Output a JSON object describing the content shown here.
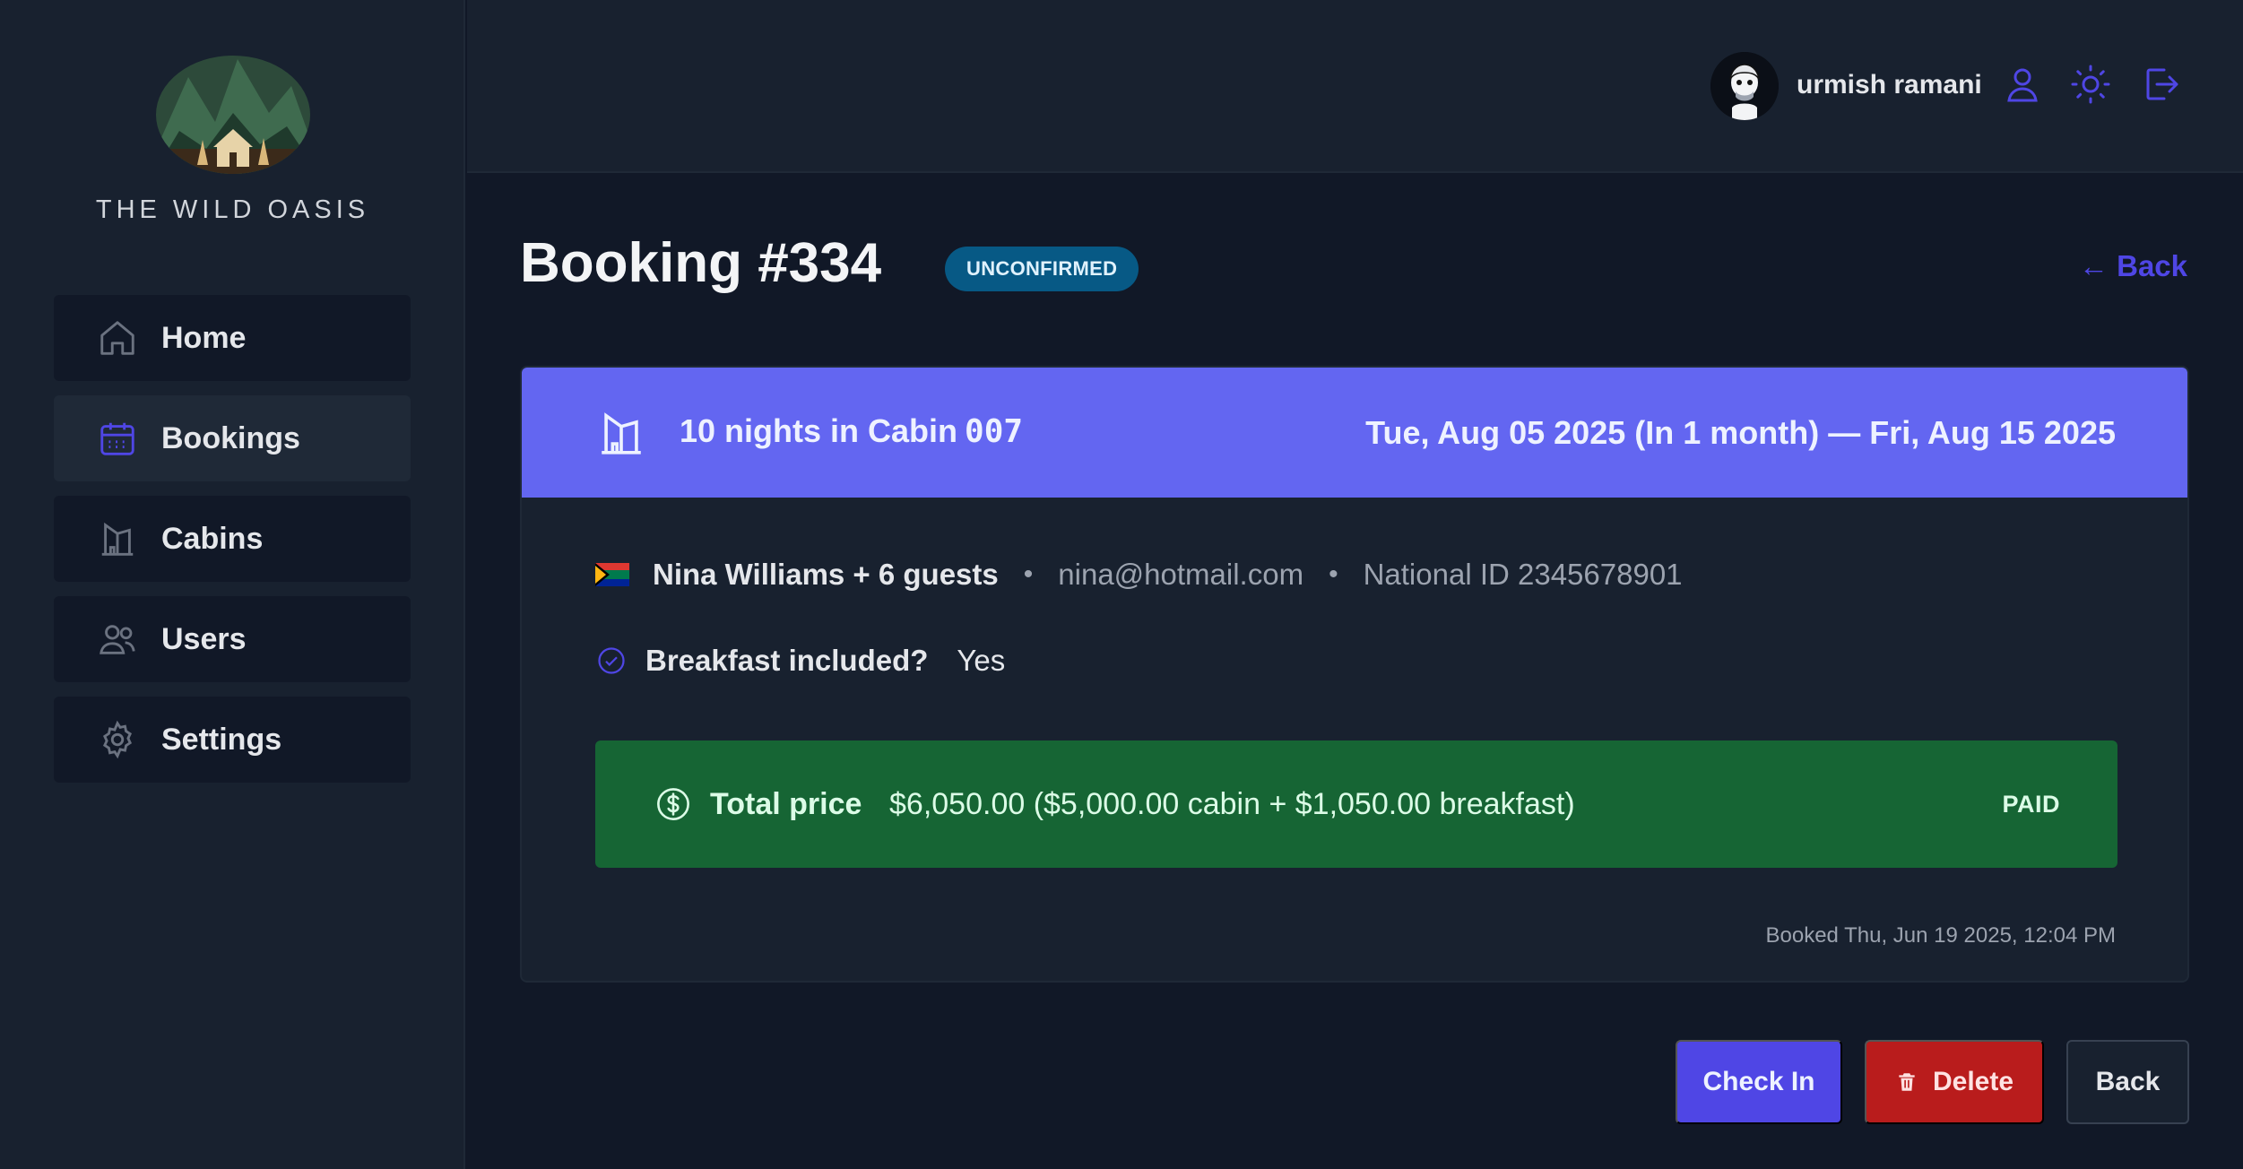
{
  "sidebar": {
    "brand": "THE WILD OASIS",
    "items": [
      {
        "label": "Home",
        "icon": "home-icon"
      },
      {
        "label": "Bookings",
        "icon": "calendar-icon"
      },
      {
        "label": "Cabins",
        "icon": "building-icon"
      },
      {
        "label": "Users",
        "icon": "users-icon"
      },
      {
        "label": "Settings",
        "icon": "gear-icon"
      }
    ],
    "active": "Bookings"
  },
  "header": {
    "username": "urmish ramani",
    "icons": [
      "user-icon",
      "sun-icon",
      "logout-icon"
    ]
  },
  "page": {
    "title": "Booking #334",
    "status": "UNCONFIRMED",
    "back_link": "← Back"
  },
  "booking": {
    "nights_text": "10 nights in Cabin",
    "cabin_code": "007",
    "dates": "Tue, Aug 05 2025 (In 1 month) — Fri, Aug 15 2025",
    "guest_name": "Nina Williams + 6 guests",
    "email": "nina@hotmail.com",
    "national_id": "National ID 2345678901",
    "breakfast_label": "Breakfast included?",
    "breakfast_value": "Yes",
    "price_label": "Total price",
    "price_value": "$6,050.00 ($5,000.00 cabin + $1,050.00 breakfast)",
    "paid_status": "PAID",
    "booked_at": "Booked Thu, Jun 19 2025, 12:04 PM"
  },
  "actions": {
    "check_in": "Check In",
    "delete": "Delete",
    "back": "Back"
  },
  "colors": {
    "accent": "#4f46e5",
    "header_band": "#6366f1",
    "paid_green": "#166534",
    "delete_red": "#b91c1c",
    "status_blue": "#075985"
  }
}
